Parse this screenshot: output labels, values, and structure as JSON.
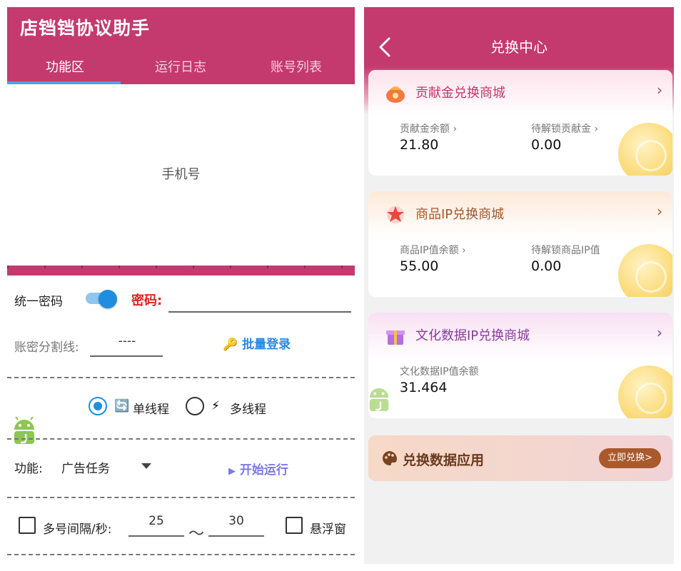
{
  "left_app": {
    "title": "店铛铛协议助手",
    "tabs": [
      {
        "label": "功能区",
        "active": true
      },
      {
        "label": "运行日志",
        "active": false
      },
      {
        "label": "账号列表",
        "active": false
      }
    ],
    "phone_placeholder": "手机号",
    "unified_password_label": "统一密码",
    "unified_password_on": true,
    "password_label": "密码:",
    "separator_label": "账密分割线:",
    "separator_value": "----",
    "batch_login": "批量登录",
    "batch_login_icon": "🔑",
    "single_thread": "单线程",
    "single_thread_icon": "🔄",
    "multi_thread": "多线程",
    "multi_thread_icon": "⚡",
    "thread_mode": "single",
    "function_label": "功能:",
    "function_value": "广告任务",
    "start_run": "开始运行",
    "start_run_icon": "▶",
    "interval_label": "多号间隔/秒:",
    "interval_min": "25",
    "interval_tilde": "～",
    "interval_max": "30",
    "float_window": "悬浮窗",
    "colors": {
      "brand": "#c43a6e",
      "accent": "#1e8ee0",
      "danger": "#e02424",
      "start": "#7b78e8"
    }
  },
  "right_app": {
    "title": "兑换中心",
    "cards": [
      {
        "title": "贡献金兑换商城",
        "title_color": "#c2376a",
        "stats": [
          {
            "label": "贡献金余额 ›",
            "value": "21.80"
          },
          {
            "label": "待解锁贡献金 ›",
            "value": "0.00"
          }
        ]
      },
      {
        "title": "商品IP兑换商城",
        "title_color": "#a4562a",
        "stats": [
          {
            "label": "商品IP值余额 ›",
            "value": "55.00"
          },
          {
            "label": "待解锁商品IP值",
            "value": "0.00"
          }
        ]
      },
      {
        "title": "文化数据IP兑换商城",
        "title_color": "#8b3a9e",
        "stats": [
          {
            "label": "文化数据IP值余额",
            "value": "31.464"
          }
        ]
      }
    ],
    "chevron": "›",
    "app_card": {
      "title": "兑换数据应用",
      "button": "立即兑换>"
    }
  }
}
